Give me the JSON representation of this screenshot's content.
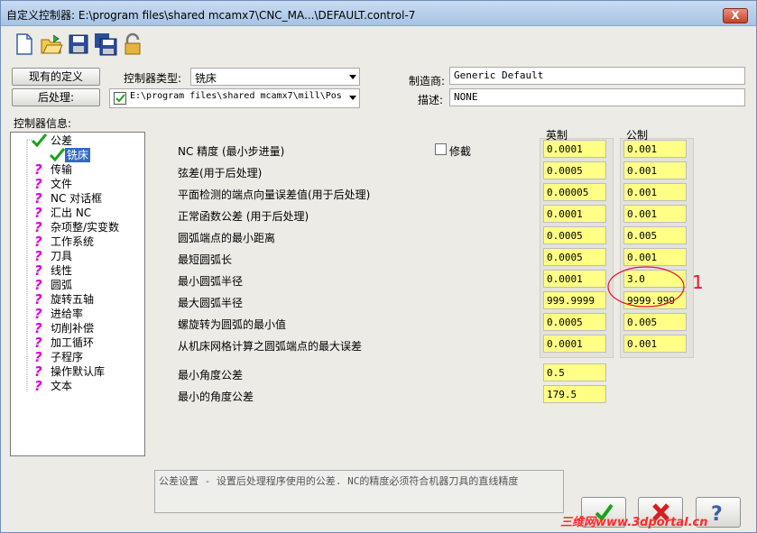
{
  "window": {
    "title": "自定义控制器: E:\\program files\\shared mcamx7\\CNC_MA...\\DEFAULT.control-7",
    "close_glyph": "X"
  },
  "toolbar": {
    "icons": [
      "new-file-icon",
      "open-folder-icon",
      "save-icon",
      "save-all-icon",
      "lock-icon"
    ]
  },
  "top": {
    "existing_def_button": "现有的定义",
    "controller_type_label": "控制器类型:",
    "controller_type_value": "铣床",
    "post_button": "后处理:",
    "post_path": "E:\\program files\\shared mcamx7\\mill\\Pos",
    "manufacturer_label": "制造商:",
    "manufacturer_value": "Generic Default",
    "description_label": "描述:",
    "description_value": "NONE"
  },
  "tree": {
    "label": "控制器信息:",
    "root": "公差",
    "selected": "铣床",
    "items": [
      "传输",
      "文件",
      "NC 对话框",
      "汇出 NC",
      "杂项整/实变数",
      "工作系统",
      "刀具",
      "线性",
      "圆弧",
      "旋转五轴",
      "进给率",
      "切削补偿",
      "加工循环",
      "子程序",
      "操作默认库",
      "文本"
    ]
  },
  "main": {
    "modify_label": "修截",
    "col_inch": "英制",
    "col_metric": "公制",
    "rows": [
      {
        "label": "NC 精度 (最小步进量)",
        "inch": "0.0001",
        "metric": "0.001"
      },
      {
        "label": "弦差(用于后处理)",
        "inch": "0.0005",
        "metric": "0.001"
      },
      {
        "label": "平面检测的端点向量误差值(用于后处理)",
        "inch": "0.00005",
        "metric": "0.001"
      },
      {
        "label": "正常函数公差  (用于后处理)",
        "inch": "0.0001",
        "metric": "0.001"
      },
      {
        "label": "圆弧端点的最小距离",
        "inch": "0.0005",
        "metric": "0.005"
      },
      {
        "label": "最短圆弧长",
        "inch": "0.0005",
        "metric": "0.001"
      },
      {
        "label": "最小圆弧半径",
        "inch": "0.0001",
        "metric": "3.0"
      },
      {
        "label": "最大圆弧半径",
        "inch": "999.9999",
        "metric": "9999.999"
      },
      {
        "label": "螺旋转为圆弧的最小值",
        "inch": "0.0005",
        "metric": "0.005"
      },
      {
        "label": "从机床网格计算之圆弧端点的最大误差",
        "inch": "0.0001",
        "metric": "0.001"
      }
    ],
    "angle_rows": [
      {
        "label": "最小角度公差",
        "value": "0.5"
      },
      {
        "label": "最小的角度公差",
        "value": "179.5"
      }
    ],
    "annotation_number": "1",
    "description_text": "公差设置 - 设置后处理程序使用的公差. NC的精度必须符合机器刀具的直线精度"
  },
  "buttons": {
    "ok_icon": "checkmark-icon",
    "cancel_icon": "red-x-icon",
    "help_icon": "question-icon"
  },
  "watermark": "三维网www.3dportal.cn",
  "colors": {
    "yellow_field": "#ffff86",
    "check_green": "#19a31a",
    "question_magenta": "#d900d9",
    "annotation_red": "#e8142d",
    "tree_select": "#316ac5"
  }
}
